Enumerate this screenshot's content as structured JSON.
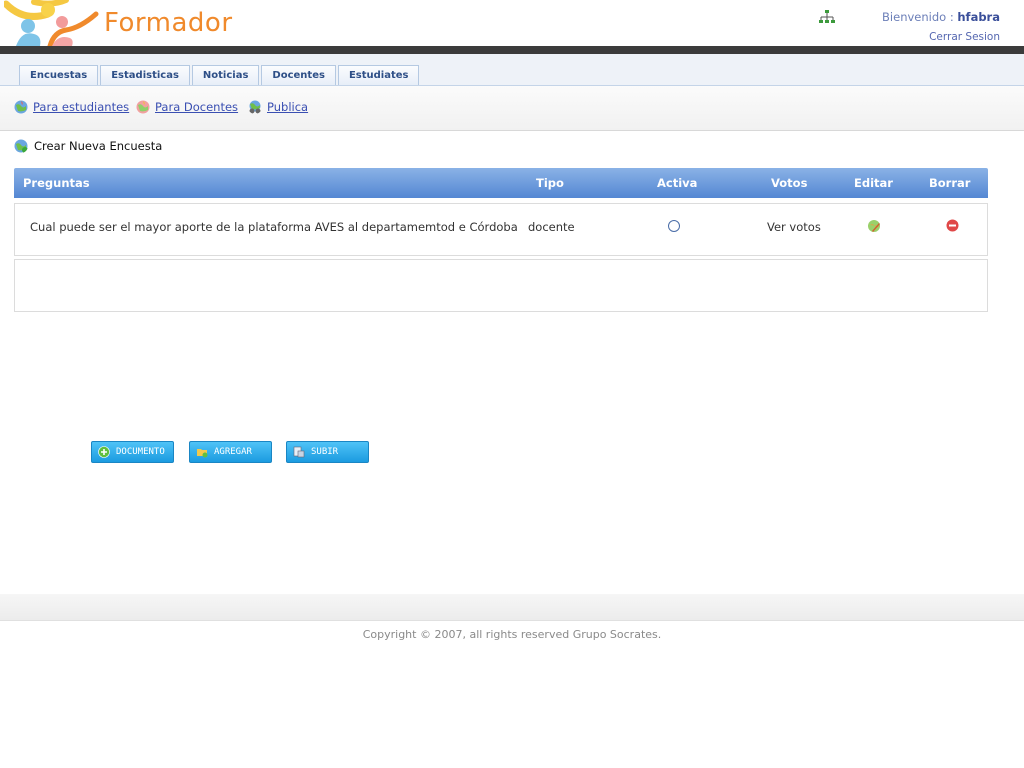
{
  "header": {
    "logo_text": "Formador",
    "welcome_prefix": "Bienvenido :",
    "username": "hfabra",
    "logout_label": "Cerrar Sesion"
  },
  "tabs": [
    {
      "label": "Encuestas"
    },
    {
      "label": "Estadisticas"
    },
    {
      "label": "Noticias"
    },
    {
      "label": "Docentes"
    },
    {
      "label": "Estudiates"
    }
  ],
  "subnav": [
    {
      "label": "Para estudiantes"
    },
    {
      "label": "Para Docentes"
    },
    {
      "label": "Publica"
    }
  ],
  "create_label": "Crear Nueva Encuesta",
  "table": {
    "columns": [
      "Preguntas",
      "Tipo",
      "Activa",
      "Votos",
      "Editar",
      "Borrar"
    ],
    "rows": [
      {
        "pregunta": "Cual puede ser el mayor aporte de la plataforma AVES al departamemtod e Córdoba",
        "tipo": "docente",
        "votos": "Ver votos"
      }
    ]
  },
  "buttons": {
    "documento": "DOCUMENTO",
    "agregar": "AGREGAR",
    "subir": "SUBIR"
  },
  "footer": {
    "copyright": "Copyright © 2007, all rights reserved Grupo Socrates."
  },
  "colors": {
    "brand_orange": "#f08a2c",
    "table_header": "#5a8bd6",
    "button_blue": "#2aa8ea",
    "link_blue": "#3a4fb2"
  }
}
